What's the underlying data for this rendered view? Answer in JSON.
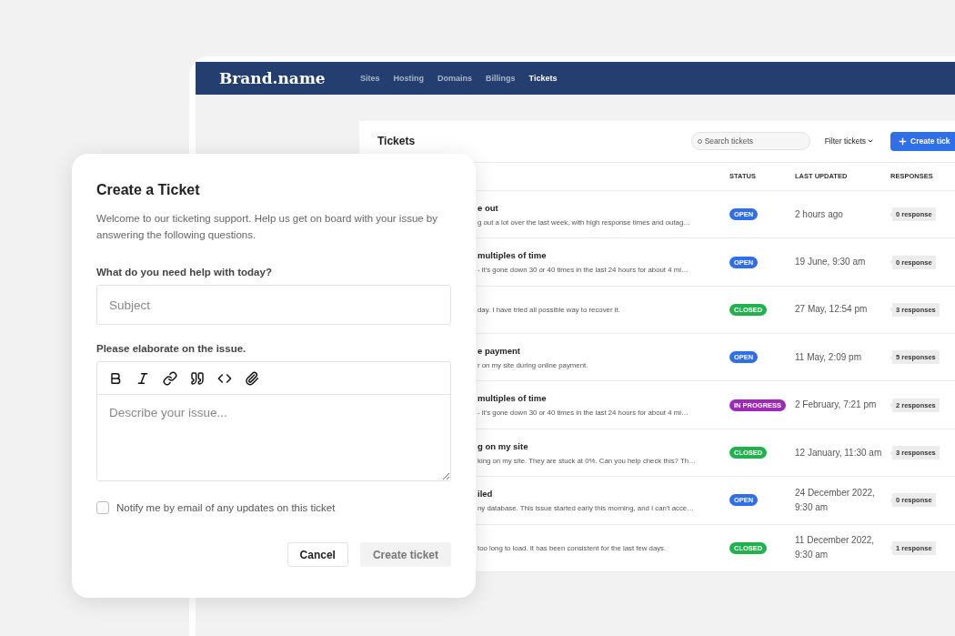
{
  "navbar": {
    "brand": "Brand.name",
    "links": [
      {
        "label": "Sites",
        "selected": false
      },
      {
        "label": "Hosting",
        "selected": false
      },
      {
        "label": "Domains",
        "selected": false
      },
      {
        "label": "Billings",
        "selected": false
      },
      {
        "label": "Tickets",
        "selected": true
      }
    ]
  },
  "tickets": {
    "title": "Tickets",
    "search": {
      "placeholder": "Search tickets"
    },
    "filter": "Filter tickets",
    "create_button": "Create tick",
    "columns": [
      "STATUS",
      "LAST UPDATED",
      "RESPONSES"
    ],
    "rows": [
      {
        "title": "e out",
        "description": "g out a lot over the last week, with high response times and outag…",
        "status": {
          "label": "OPEN",
          "color": "#2f6fe8"
        },
        "updated": "2 hours ago",
        "responses": "0 response"
      },
      {
        "title": "multiples of time",
        "description": "- it’s gone down 30 or 40 times in the last 24 hours for about 4 mi…",
        "status": {
          "label": "OPEN",
          "color": "#2f6fe8"
        },
        "updated": "19 June, 9:30 am",
        "responses": "0 response"
      },
      {
        "description": "day. I  have tried all possible way to recover it.",
        "status": {
          "label": "CLOSED",
          "color": "#22b14c"
        },
        "updated": "27 May, 12:54 pm",
        "responses": "3 responses"
      },
      {
        "title": "e payment",
        "description": "r on my site during online payment.",
        "status": {
          "label": "OPEN",
          "color": "#2f6fe8"
        },
        "updated": "11 May, 2:09 pm",
        "responses": "5 responses"
      },
      {
        "title": "multiples of time",
        "description": "- it’s gone down 30 or 40 times in the last 24 hours for about 4 mi…",
        "status": {
          "label": "IN PROGRESS",
          "color": "#9b2bb5"
        },
        "updated": "2 February, 7:21 pm",
        "responses": "2 responses"
      },
      {
        "title": "g on my site",
        "description": "king on my site. They are stuck at 0%. Can you help check this? Th…",
        "status": {
          "label": "CLOSED",
          "color": "#22b14c"
        },
        "updated": "12 January, 11:30 am",
        "responses": "3 responses"
      },
      {
        "title": "iled",
        "description": "ny database. This issue started early this morning, and I can't acce…",
        "status": {
          "label": "OPEN",
          "color": "#2f6fe8"
        },
        "updated": "24 December 2022, 9:30 am",
        "responses": "0 response"
      },
      {
        "description": "too long to load. It has been consistent for the last few days.",
        "status": {
          "label": "CLOSED",
          "color": "#22b14c"
        },
        "updated": "11 December 2022, 9:30 am",
        "responses": "1 response"
      }
    ]
  },
  "modal": {
    "title": "Create a Ticket",
    "intro": "Welcome to our ticketing support. Help us get on board with your issue by answering the following questions.",
    "subject_label": "What do you need help with today?",
    "subject": {
      "placeholder": "Subject"
    },
    "details_label": "Please elaborate on the issue.",
    "details": {
      "placeholder": "Describe your issue..."
    },
    "notify": {
      "label": "Notify me by email of any updates on this ticket",
      "checked": false
    },
    "buttons": [
      {
        "label": "Cancel",
        "kind": "secondary",
        "disabled": false
      },
      {
        "label": "Create ticket",
        "kind": "primary",
        "disabled": true
      }
    ]
  }
}
